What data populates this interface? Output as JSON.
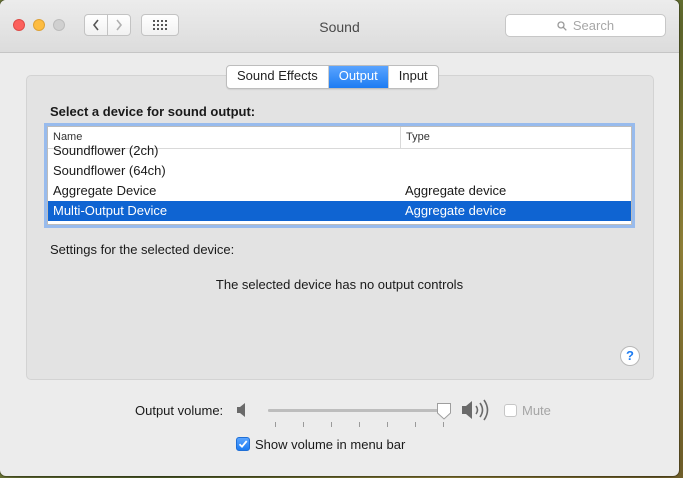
{
  "window": {
    "title": "Sound"
  },
  "search": {
    "placeholder": "Search"
  },
  "tabs": [
    {
      "label": "Sound Effects",
      "active": false
    },
    {
      "label": "Output",
      "active": true
    },
    {
      "label": "Input",
      "active": false
    }
  ],
  "output": {
    "section_title": "Select a device for sound output:",
    "columns": {
      "name": "Name",
      "type": "Type"
    },
    "devices": [
      {
        "name": "Soundflower (2ch)",
        "type": ""
      },
      {
        "name": "Soundflower (64ch)",
        "type": ""
      },
      {
        "name": "Aggregate Device",
        "type": "Aggregate device"
      },
      {
        "name": "Multi-Output Device",
        "type": "Aggregate device",
        "selected": true
      }
    ],
    "settings_label": "Settings for the selected device:",
    "no_controls_message": "The selected device has no output controls"
  },
  "help": {
    "label": "?"
  },
  "volume": {
    "label": "Output volume:",
    "level": 0.98,
    "mute_label": "Mute",
    "mute_checked": false,
    "show_in_menu_bar_label": "Show volume in menu bar",
    "show_in_menu_bar_checked": true
  },
  "colors": {
    "accent": "#1d7cf2",
    "selection": "#0f64d2"
  }
}
